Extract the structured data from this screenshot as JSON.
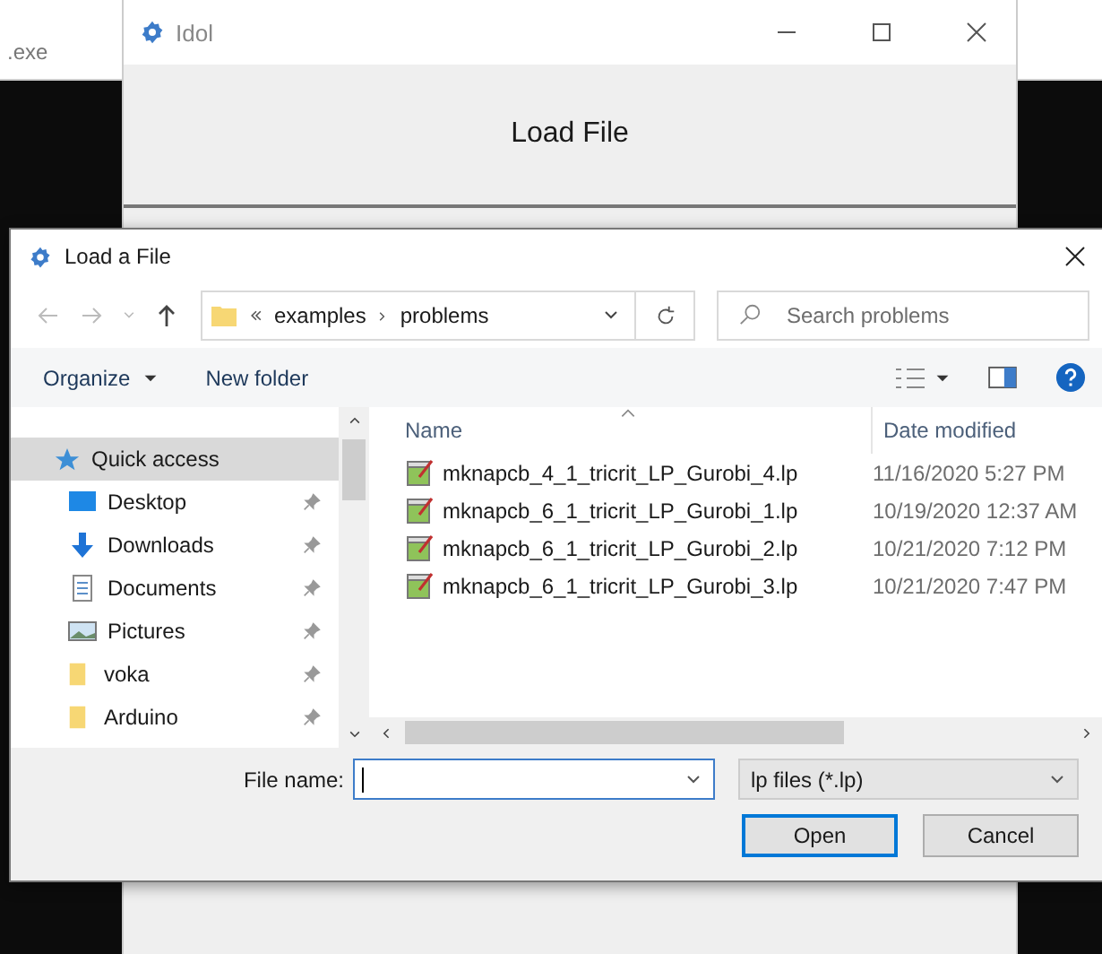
{
  "background_window": {
    "title": ".exe"
  },
  "app_window": {
    "title": "Idol",
    "button": "Load File"
  },
  "dialog": {
    "title": "Load a File",
    "breadcrumb": [
      "examples",
      "problems"
    ],
    "search": {
      "placeholder": "Search problems"
    },
    "toolbar": {
      "organize": "Organize",
      "new_folder": "New folder"
    },
    "nav_items": [
      {
        "kind": "quick",
        "label": "Quick access",
        "selected": true,
        "pinned": false
      },
      {
        "kind": "desktop",
        "label": "Desktop",
        "selected": false,
        "pinned": true
      },
      {
        "kind": "downloads",
        "label": "Downloads",
        "selected": false,
        "pinned": true
      },
      {
        "kind": "documents",
        "label": "Documents",
        "selected": false,
        "pinned": true
      },
      {
        "kind": "pictures",
        "label": "Pictures",
        "selected": false,
        "pinned": true
      },
      {
        "kind": "folder",
        "label": "voka",
        "selected": false,
        "pinned": true
      },
      {
        "kind": "folder",
        "label": "Arduino",
        "selected": false,
        "pinned": true
      }
    ],
    "columns": [
      "Name",
      "Date modified"
    ],
    "files": [
      {
        "name": "mknapcb_4_1_tricrit_LP_Gurobi_4.lp",
        "date": "11/16/2020 5:27 PM"
      },
      {
        "name": "mknapcb_6_1_tricrit_LP_Gurobi_1.lp",
        "date": "10/19/2020 12:37 AM"
      },
      {
        "name": "mknapcb_6_1_tricrit_LP_Gurobi_2.lp",
        "date": "10/21/2020 7:12 PM"
      },
      {
        "name": "mknapcb_6_1_tricrit_LP_Gurobi_3.lp",
        "date": "10/21/2020 7:47 PM"
      }
    ],
    "file_name_label": "File name:",
    "filter": "lp files (*.lp)",
    "buttons": [
      {
        "label": "Open",
        "default": true
      },
      {
        "label": "Cancel",
        "default": false
      }
    ]
  }
}
